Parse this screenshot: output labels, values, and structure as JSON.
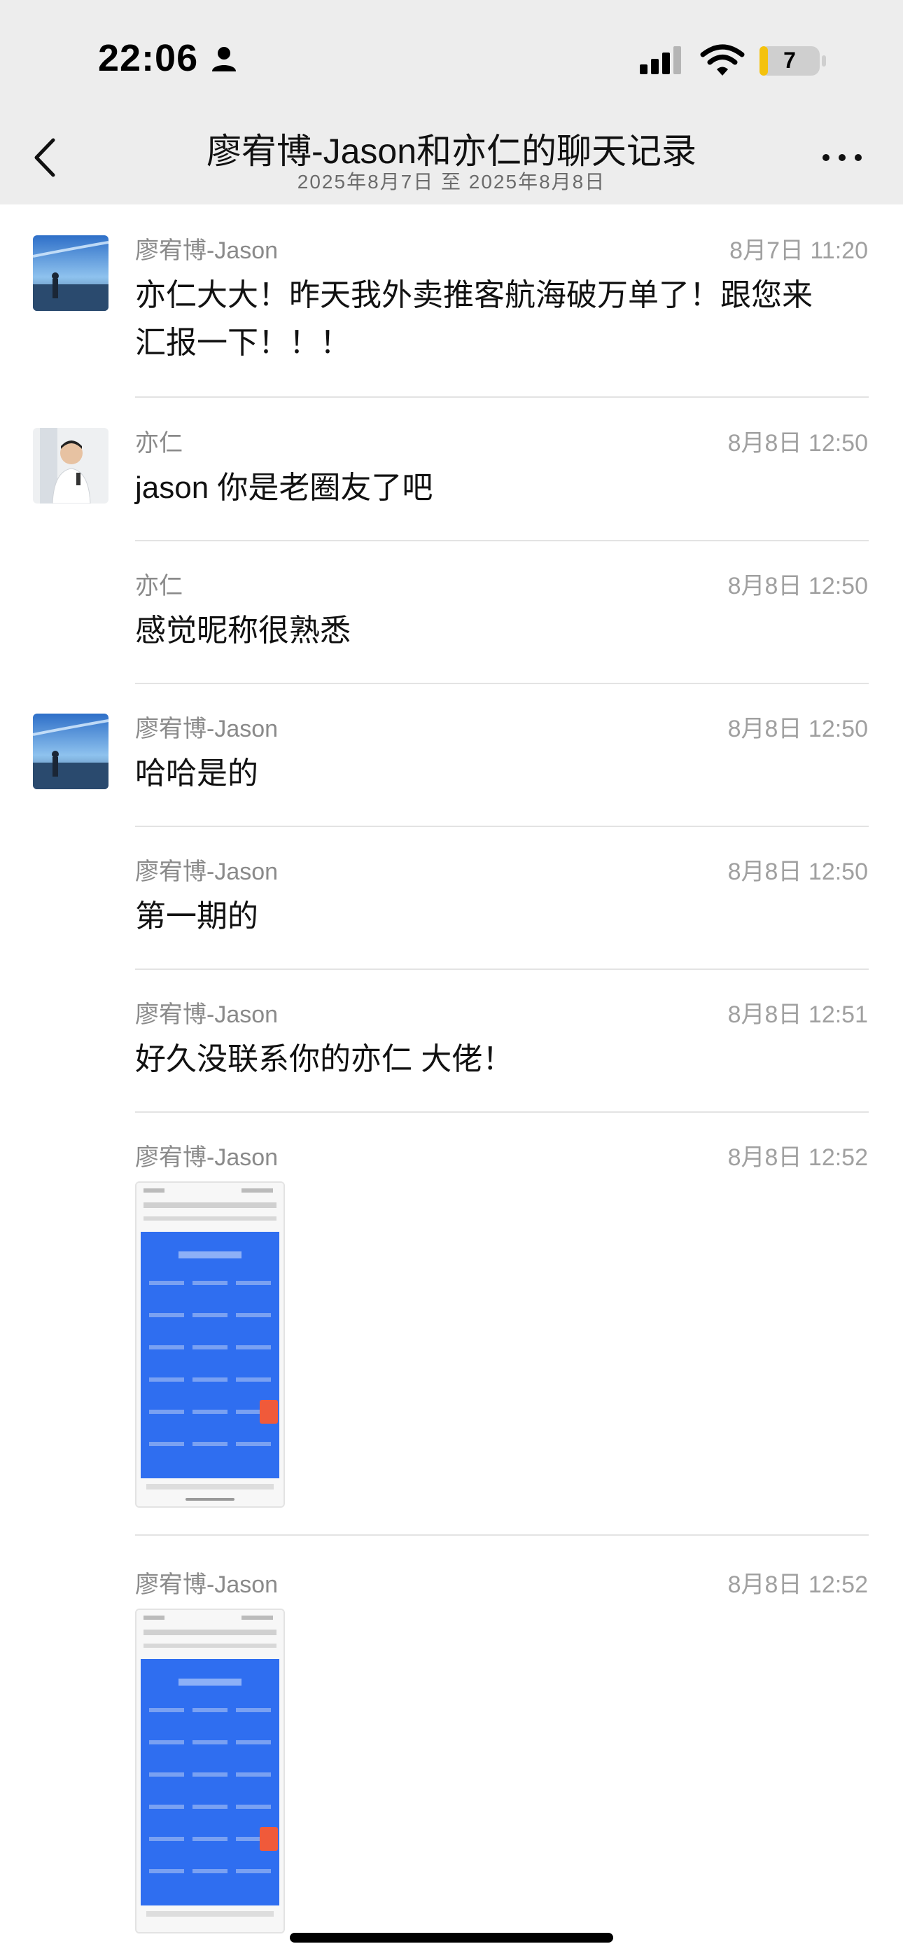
{
  "status_bar": {
    "time": "22:06",
    "battery": "7"
  },
  "header": {
    "title": "廖宥博-Jason和亦仁的聊天记录",
    "subtitle": "2025年8月7日 至 2025年8月8日"
  },
  "messages": [
    {
      "sender": "廖宥博-Jason",
      "time": "8月7日 11:20",
      "text_line1": "亦仁大大！昨天我外卖推客航海破万单了！跟您来",
      "text_line2": "汇报一下！！！"
    },
    {
      "sender": "亦仁",
      "time": "8月8日 12:50",
      "text": "jason 你是老圈友了吧"
    },
    {
      "sender": "亦仁",
      "time": "8月8日 12:50",
      "text": "感觉昵称很熟悉"
    },
    {
      "sender": "廖宥博-Jason",
      "time": "8月8日 12:50",
      "text": "哈哈是的"
    },
    {
      "sender": "廖宥博-Jason",
      "time": "8月8日 12:50",
      "text": "第一期的"
    },
    {
      "sender": "廖宥博-Jason",
      "time": "8月8日 12:51",
      "text": "好久没联系你的亦仁 大佬！"
    },
    {
      "sender": "廖宥博-Jason",
      "time": "8月8日 12:52"
    },
    {
      "sender": "廖宥博-Jason",
      "time": "8月8日 12:52"
    }
  ],
  "colors": {
    "header_bg": "#ededed",
    "thumbnail_blue": "#2f6ef0",
    "divider": "#e3e3e3"
  },
  "icons": [
    "person-icon",
    "signal-icon",
    "wifi-icon",
    "battery-icon",
    "back-chevron-icon",
    "more-dots-icon"
  ]
}
